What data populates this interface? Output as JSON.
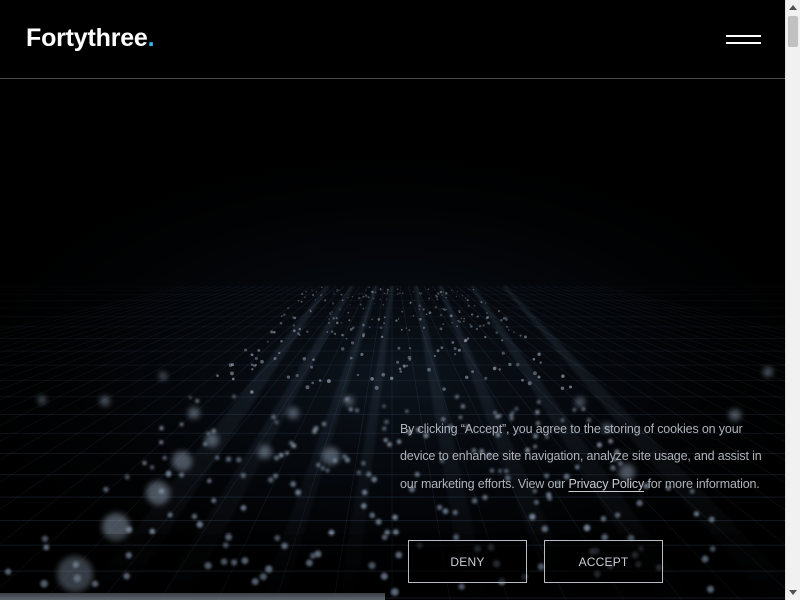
{
  "header": {
    "logo_text": "Fortythree",
    "logo_dot": ".",
    "menu_icon": "hamburger-menu-icon"
  },
  "colors": {
    "background": "#000000",
    "logo_accent": "#35b8f2",
    "text_muted": "#aeb3bb",
    "button_border": "#b8bcc4"
  },
  "hero": {
    "visual": "perspective data grid with glowing particles"
  },
  "cookie_banner": {
    "text_before_link": "By clicking “Accept”, you agree to the storing of cookies on your device to enhance site navigation, analyze site usage, and assist in our marketing efforts. View our ",
    "privacy_link_text": "Privacy Policy",
    "text_after_link": " for more information.",
    "deny_label": "DENY",
    "accept_label": "ACCEPT"
  },
  "scrollbar": {
    "up_icon": "scroll-up-arrow-icon",
    "down_icon": "scroll-down-arrow-icon"
  }
}
